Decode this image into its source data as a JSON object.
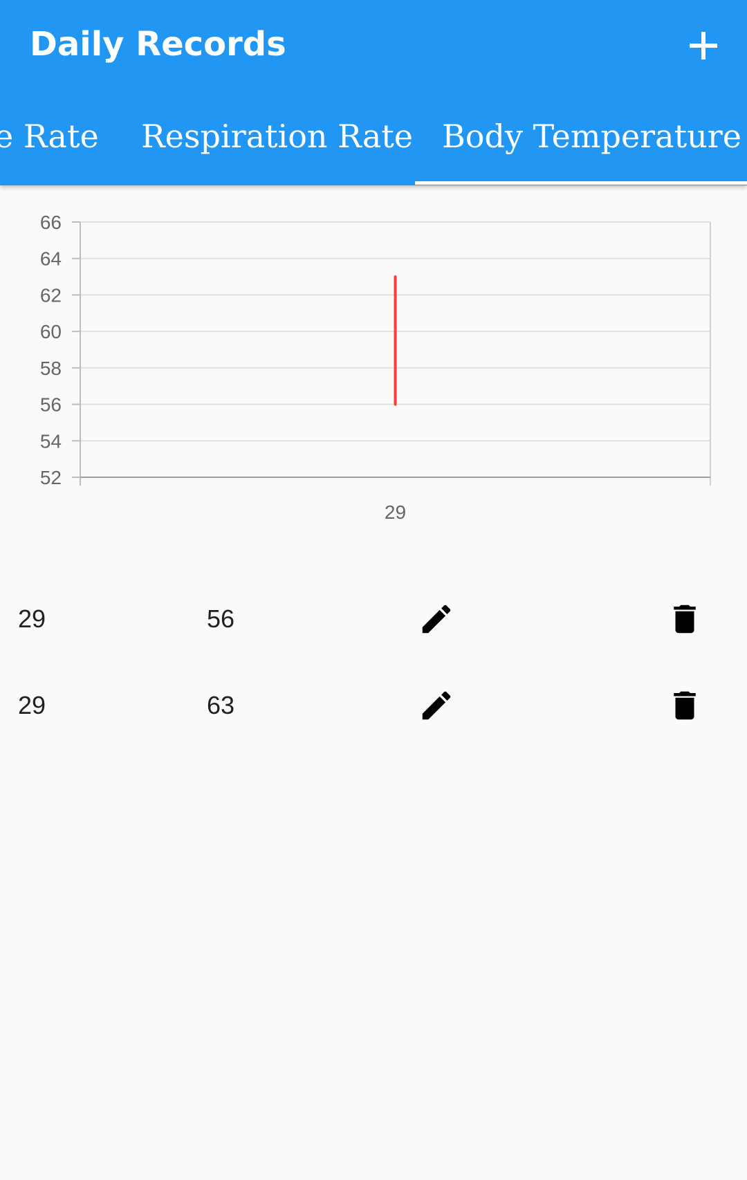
{
  "app_bar": {
    "title": "Daily Records",
    "add_icon": "add-icon",
    "background": "#2196F3"
  },
  "tabs": [
    {
      "label": "Pulse Rate",
      "visible_label": "e Rate",
      "selected": false
    },
    {
      "label": "Respiration Rate",
      "selected": false
    },
    {
      "label": "Body Temperature",
      "selected": true
    }
  ],
  "chart_data": {
    "type": "line",
    "x": [
      "29"
    ],
    "y_tick_labels": [
      "52",
      "54",
      "56",
      "58",
      "60",
      "62",
      "64",
      "66"
    ],
    "ylim": [
      52,
      66
    ],
    "grid": true,
    "series": [
      {
        "color": "#F44336",
        "points": [
          {
            "x": "29",
            "y": 56
          },
          {
            "x": "29",
            "y": 63
          }
        ]
      }
    ]
  },
  "records": [
    {
      "date": "29",
      "value": "56",
      "edit_icon": "edit-icon",
      "delete_icon": "delete-icon"
    },
    {
      "date": "29",
      "value": "63",
      "edit_icon": "edit-icon",
      "delete_icon": "delete-icon"
    }
  ]
}
